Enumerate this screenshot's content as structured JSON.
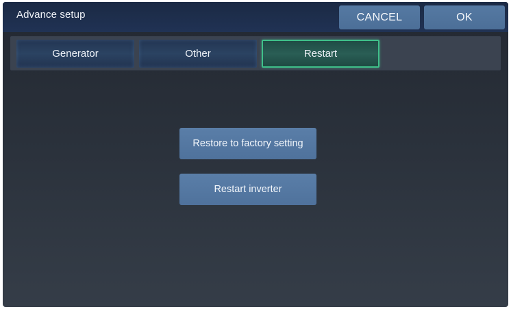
{
  "header": {
    "title": "Advance setup",
    "cancel_label": "CANCEL",
    "ok_label": "OK"
  },
  "tabs": [
    {
      "label": "Generator",
      "active": false
    },
    {
      "label": "Other",
      "active": false
    },
    {
      "label": "Restart",
      "active": true
    }
  ],
  "actions": {
    "restore_factory_label": "Restore to factory setting",
    "restart_inverter_label": "Restart inverter"
  },
  "colors": {
    "header_bg": "#1e2f4e",
    "button_bg": "#5176a0",
    "active_tab_border": "#3fc08a",
    "panel_bg": "#2a313b"
  }
}
